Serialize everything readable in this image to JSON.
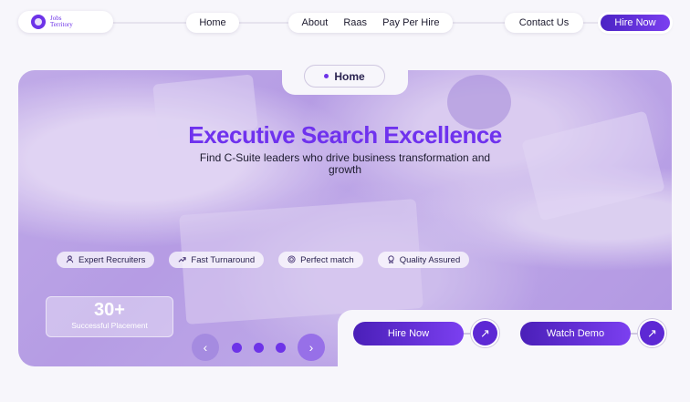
{
  "nav": {
    "logo_line1": "Jobs",
    "logo_line2": "Territory",
    "home": "Home",
    "about": "About",
    "raas": "Raas",
    "pay_per_hire": "Pay Per Hire",
    "contact": "Contact Us",
    "hire_now": "Hire Now"
  },
  "breadcrumb": {
    "label": "Home"
  },
  "hero": {
    "title": "Executive Search Excellence",
    "subtitle": "Find C-Suite leaders who drive business transformation and growth",
    "chips": [
      {
        "label": "Expert Recruiters",
        "icon": "users-icon"
      },
      {
        "label": "Fast Turnaround",
        "icon": "trend-up-icon"
      },
      {
        "label": "Perfect match",
        "icon": "target-icon"
      },
      {
        "label": "Quality Assured",
        "icon": "badge-icon"
      }
    ],
    "stat": {
      "value": "30+",
      "label": "Successful Placement"
    },
    "carousel": {
      "prev": "‹",
      "next": "›",
      "slides": 3
    }
  },
  "cta": {
    "hire_now": "Hire Now",
    "watch_demo": "Watch Demo",
    "arrow": "↗"
  },
  "colors": {
    "accent": "#6d33e8",
    "title": "#6f32ee",
    "background": "#f7f6fb"
  }
}
